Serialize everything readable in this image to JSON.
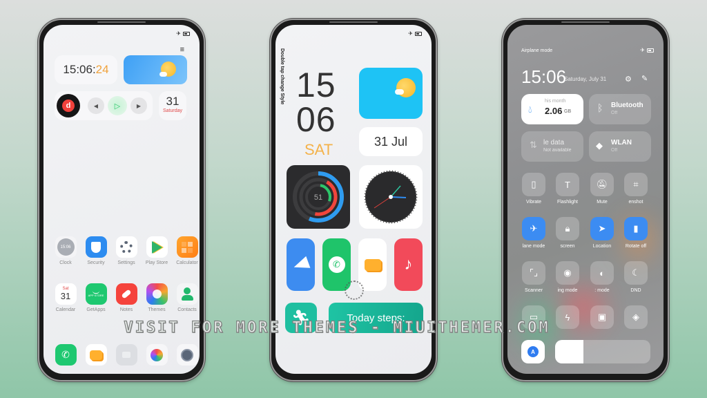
{
  "watermark": "VISIT FOR MORE THEMES - MIUITHEMER.COM",
  "phone1": {
    "clock": {
      "hm": "15:06:",
      "sec": "24"
    },
    "date": {
      "day": "31",
      "weekday": "Saturday"
    },
    "music": {
      "app_letter": "d",
      "prev": "◀",
      "play": "▷",
      "next": "▶"
    },
    "menu_icon": "≡",
    "apps_row1": [
      {
        "label": "Clock",
        "icon": "clock-icon",
        "text": "15:06"
      },
      {
        "label": "Security",
        "icon": "security-shield-icon"
      },
      {
        "label": "Settings",
        "icon": "settings-gear-icon"
      },
      {
        "label": "Play Store",
        "icon": "play-store-icon"
      },
      {
        "label": "Calculator",
        "icon": "calculator-icon"
      }
    ],
    "apps_row2": [
      {
        "label": "Calendar",
        "icon": "calendar-icon",
        "top": "Sat",
        "day": "31"
      },
      {
        "label": "GetApps",
        "icon": "getapps-icon",
        "text": "APP STORE"
      },
      {
        "label": "Notes",
        "icon": "notes-icon"
      },
      {
        "label": "Themes",
        "icon": "themes-icon"
      },
      {
        "label": "Contacts",
        "icon": "contacts-icon"
      }
    ],
    "dock": [
      "phone-icon",
      "messages-icon",
      "store-bag-icon",
      "gallery-icon",
      "camera-icon"
    ]
  },
  "phone2": {
    "vertical_hint": "Double tap change Style",
    "hour": "15",
    "minute": "06",
    "weekday": "SAT",
    "date": "31 Jul",
    "rings_value": "51",
    "apps": [
      "telegram-icon",
      "whatsapp-icon",
      "messages-icon",
      "music-icon"
    ],
    "steps_label": "Today steps:"
  },
  "phone3": {
    "status_left": "Airplane mode",
    "time": "15:06",
    "date": "Saturday, July 31",
    "data_tile": {
      "caption": "his month",
      "value": "2.06",
      "unit": "GB"
    },
    "bluetooth": {
      "title": "Bluetooth",
      "state": "Off"
    },
    "mobile_data": {
      "title": "le data",
      "state": "Not available"
    },
    "wlan": {
      "title": "WLAN",
      "state": "Off"
    },
    "toggles": [
      {
        "label": "Vibrate",
        "icon": "vibrate-icon",
        "on": false
      },
      {
        "label": "Flashlight",
        "icon": "flashlight-icon",
        "on": false
      },
      {
        "label": "Mute",
        "icon": "mute-bell-icon",
        "on": false
      },
      {
        "label": "enshot",
        "icon": "screenshot-crop-icon",
        "on": false
      },
      {
        "label": "lane mode",
        "icon": "airplane-icon",
        "on": true
      },
      {
        "label": "screen",
        "icon": "lock-screen-icon",
        "on": false
      },
      {
        "label": "Location",
        "icon": "location-icon",
        "on": true
      },
      {
        "label": "Rotate off",
        "icon": "rotate-lock-icon",
        "on": true
      },
      {
        "label": "Scanner",
        "icon": "scanner-icon",
        "on": false
      },
      {
        "label": "ing mode",
        "icon": "reading-mode-eye-icon",
        "on": false
      },
      {
        "label": ": mode",
        "icon": "dark-mode-icon",
        "on": false
      },
      {
        "label": "DND",
        "icon": "moon-icon",
        "on": false
      },
      {
        "label": "",
        "icon": "battery-saver-icon",
        "on": false
      },
      {
        "label": "",
        "icon": "performance-bolt-icon",
        "on": false
      },
      {
        "label": "",
        "icon": "cast-screen-icon",
        "on": false
      },
      {
        "label": "",
        "icon": "mi-share-icon",
        "on": false
      }
    ],
    "brightness_percent": 30,
    "auto_brightness_letter": "A"
  }
}
